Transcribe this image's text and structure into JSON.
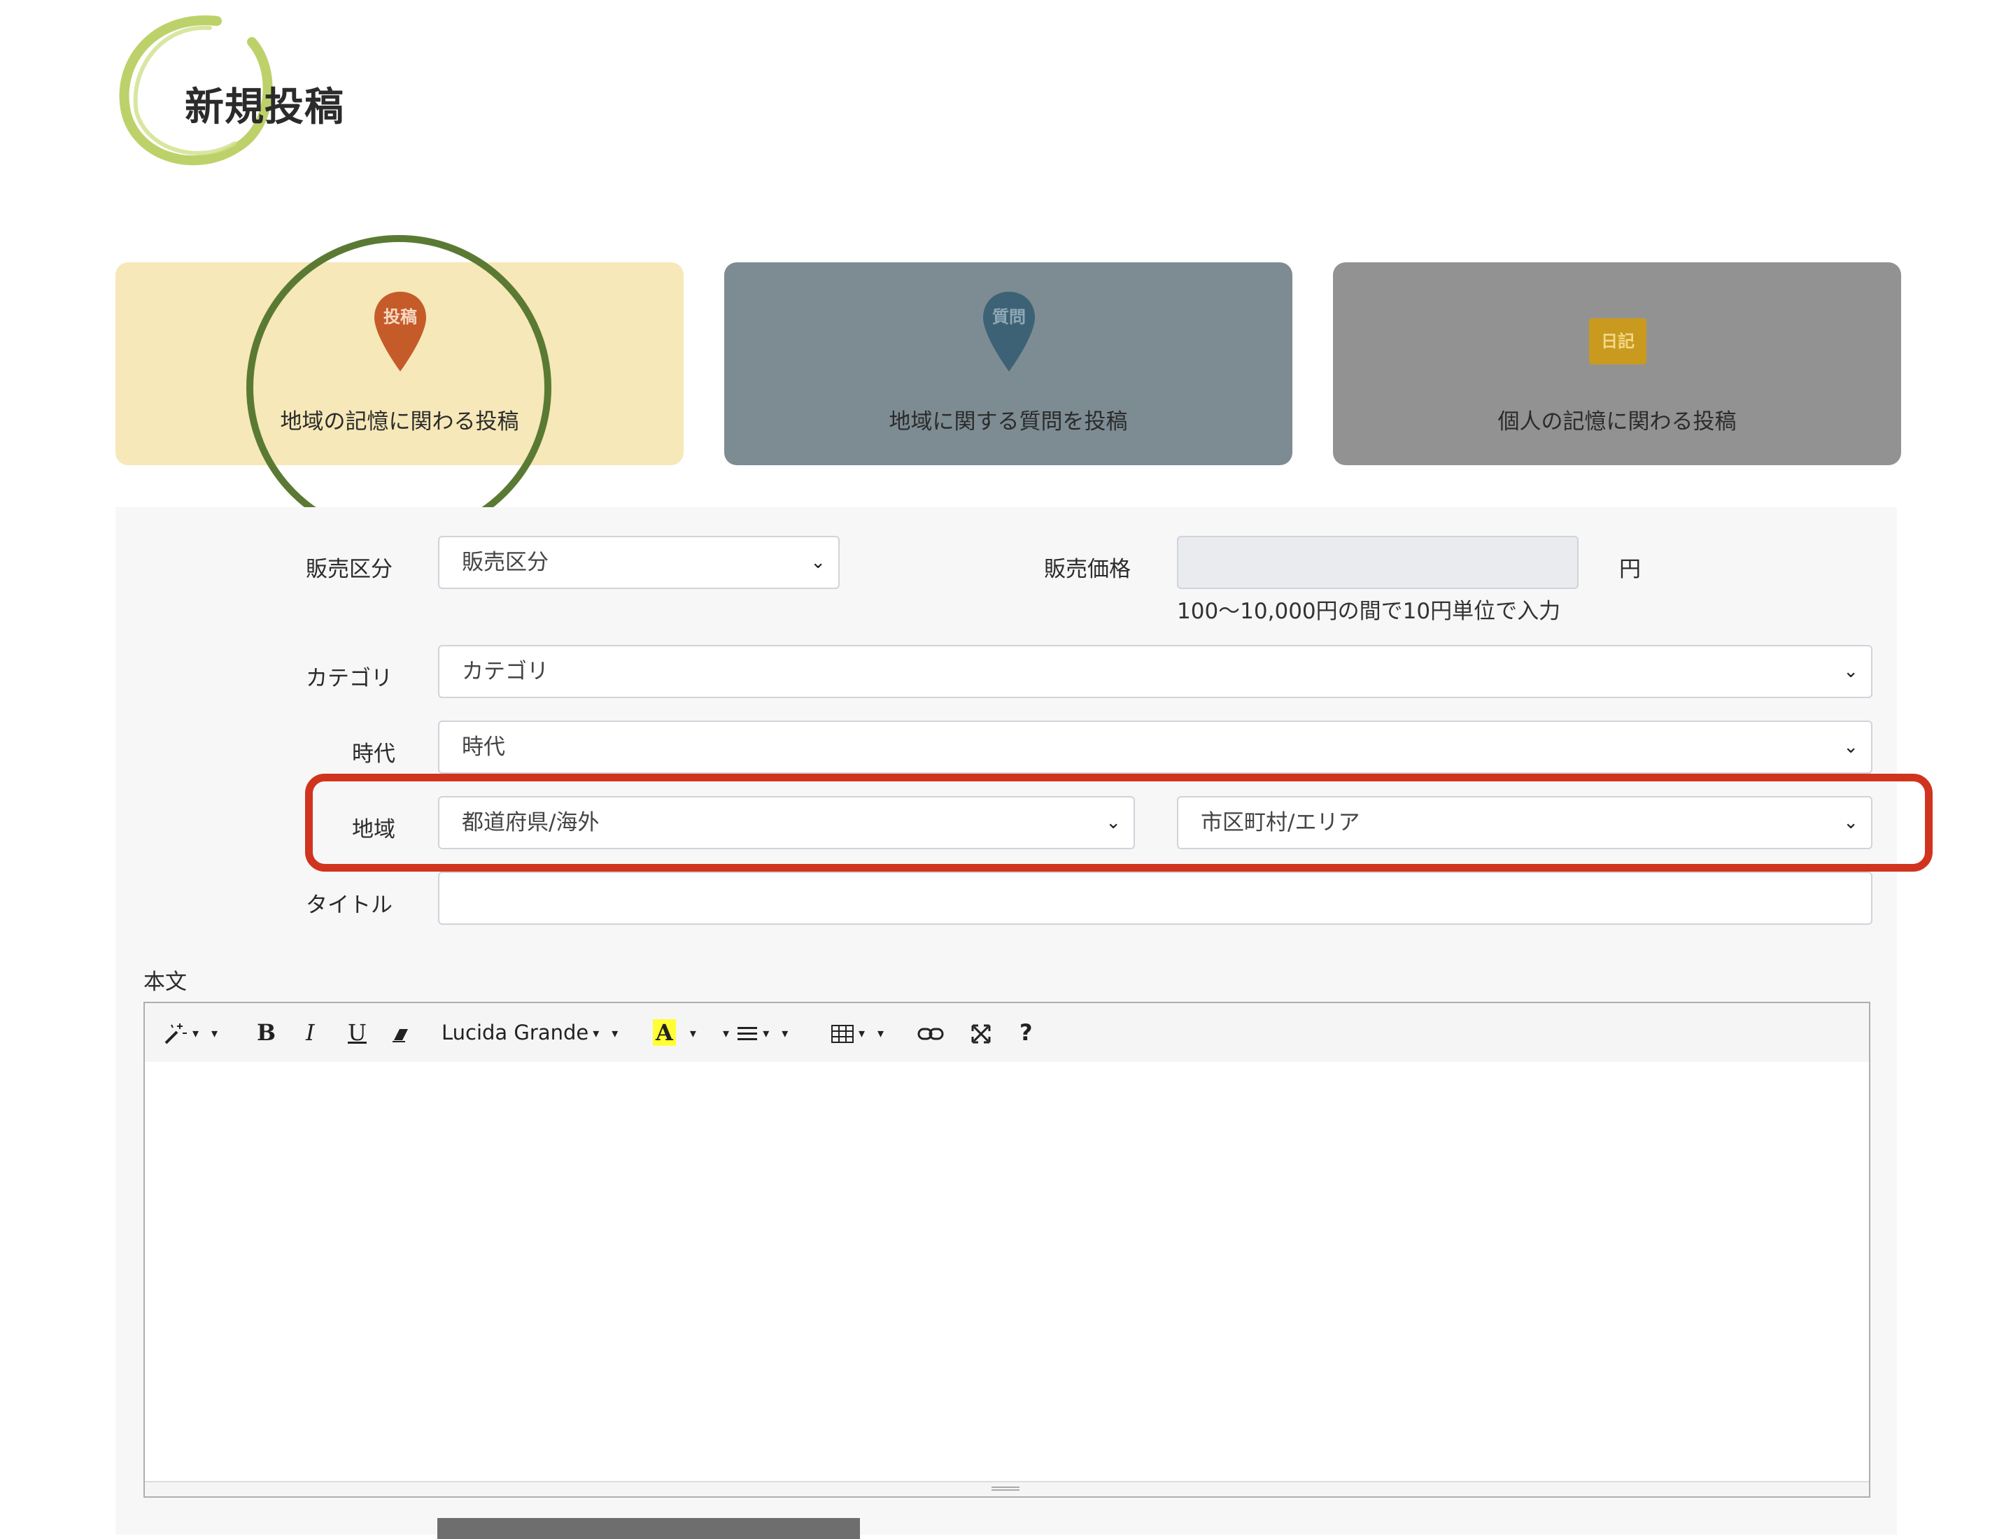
{
  "page": {
    "title": "新規投稿"
  },
  "post_types": [
    {
      "id": "local",
      "badge": "投稿",
      "label": "地域の記憶に関わる投稿",
      "color": "#c65b2a",
      "bg": "#f6e8b8"
    },
    {
      "id": "question",
      "badge": "質問",
      "label": "地域に関する質問を投稿",
      "color": "#3e6275",
      "bg": "#7d8c93"
    },
    {
      "id": "diary",
      "badge": "日記",
      "label": "個人の記憶に関わる投稿",
      "color": "#c99a1e",
      "bg": "#929292"
    }
  ],
  "form": {
    "sale_type": {
      "label": "販売区分",
      "value": "販売区分"
    },
    "price": {
      "label": "販売価格",
      "value": "",
      "unit": "円",
      "hint": "100〜10,000円の間で10円単位で入力"
    },
    "category": {
      "label": "カテゴリ",
      "value": "カテゴリ"
    },
    "era": {
      "label": "時代",
      "value": "時代"
    },
    "region": {
      "label": "地域",
      "prefecture": "都道府県/海外",
      "city": "市区町村/エリア"
    },
    "title": {
      "label": "タイトル",
      "value": ""
    },
    "body": {
      "label": "本文"
    }
  },
  "editor_toolbar": {
    "style_icon": "magic-wand-icon",
    "bold": "B",
    "italic": "I",
    "underline": "U",
    "eraser_icon": "eraser-icon",
    "font_name": "Lucida Grande",
    "color_letter": "A",
    "list_icon": "list-icon",
    "table_icon": "table-icon",
    "link_icon": "link-icon",
    "fullscreen_icon": "fullscreen-icon",
    "help": "?"
  },
  "annotations": {
    "ring_color": "#5a7a33",
    "highlight_color": "#d0341f"
  }
}
